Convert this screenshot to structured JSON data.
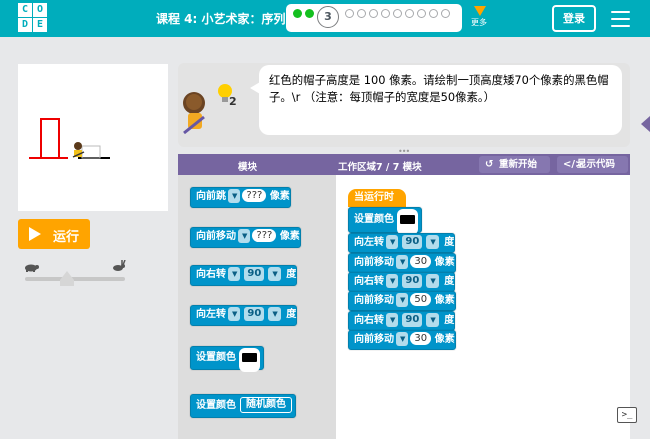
{
  "header": {
    "logo_letters": [
      "C",
      "O",
      "D",
      "E"
    ],
    "lesson_title": "课程 4: 小艺术家：序列",
    "current_level": "3",
    "more_label": "更多",
    "signin_label": "登录",
    "completed_levels": 2,
    "remaining_levels": 9,
    "colors": {
      "bar": "#00adbc",
      "done": "#14c01f",
      "more": "#ffa400"
    }
  },
  "controls": {
    "run_label": "运行"
  },
  "instructions": {
    "text": "红色的帽子高度是 100 像素。请绘制一顶高度矮70个像素的黑色帽子。\\r （注意：每顶帽子的宽度是50像素。）",
    "hint_count": "2"
  },
  "workspace_header": {
    "toolbox_label": "模块",
    "workspace_label": "工作区域7 / 7 模块",
    "reset_label": "重新开始",
    "show_code_label": "显示代码"
  },
  "toolbox": [
    {
      "parts": [
        "向前跳",
        "???",
        "像素"
      ]
    },
    {
      "parts": [
        "向前移动",
        "???",
        "像素"
      ]
    },
    {
      "parts": [
        "向右转",
        "90",
        "度"
      ]
    },
    {
      "parts": [
        "向左转",
        "90",
        "度"
      ]
    },
    {
      "parts": [
        "设置颜色"
      ]
    },
    {
      "parts": [
        "设置颜色",
        "随机颜色"
      ]
    }
  ],
  "program": {
    "start_label": "当运行时",
    "blocks": [
      {
        "parts": [
          "设置颜色"
        ]
      },
      {
        "parts": [
          "向左转",
          "90",
          "度"
        ]
      },
      {
        "parts": [
          "向前移动",
          "30",
          "像素"
        ]
      },
      {
        "parts": [
          "向右转",
          "90",
          "度"
        ]
      },
      {
        "parts": [
          "向前移动",
          "50",
          "像素"
        ]
      },
      {
        "parts": [
          "向右转",
          "90",
          "度"
        ]
      },
      {
        "parts": [
          "向前移动",
          "30",
          "像素"
        ]
      }
    ]
  },
  "console_label": ">_"
}
